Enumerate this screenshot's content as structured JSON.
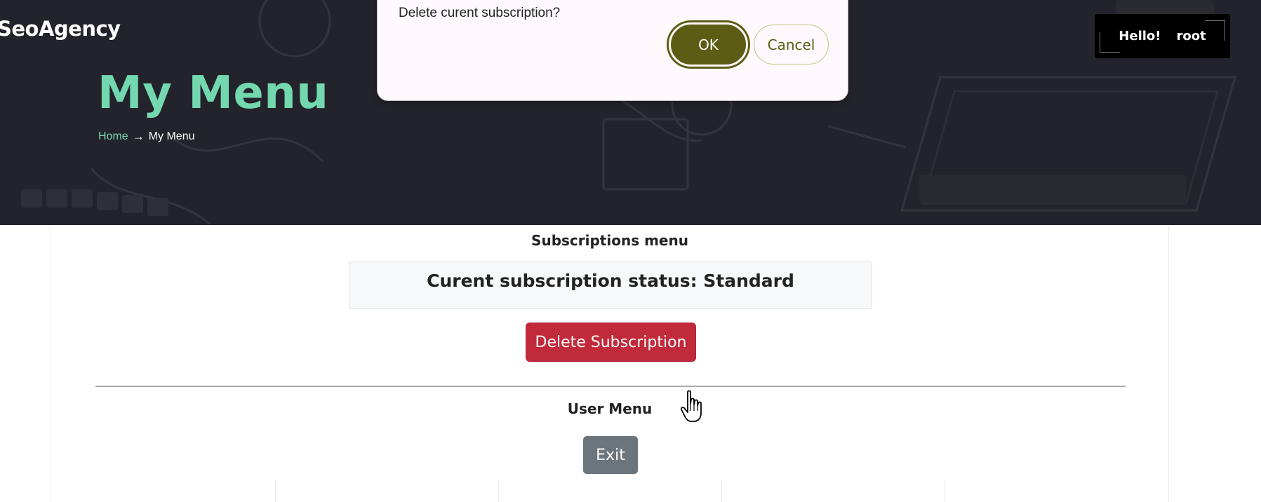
{
  "header": {
    "brand": "SeoAgency",
    "page_title": "My Menu",
    "breadcrumb": {
      "home": "Home",
      "separator": "→",
      "current": "My Menu"
    },
    "user_box": {
      "greeting": "Hello!",
      "username": "root"
    }
  },
  "dialog": {
    "message": "Delete curent subscription?",
    "ok_label": "OK",
    "cancel_label": "Cancel"
  },
  "subscriptions": {
    "title": "Subscriptions menu",
    "status_text": "Curent subscription status: Standard",
    "delete_label": "Delete Subscription"
  },
  "user_menu": {
    "title": "User Menu",
    "exit_label": "Exit"
  },
  "colors": {
    "hero_bg": "#23232b",
    "accent": "#73d8b0",
    "danger": "#c12a3b",
    "secondary": "#6b757d",
    "dialog_primary": "#5d5c14"
  },
  "icons": {
    "cursor": "hand-pointer-icon"
  }
}
